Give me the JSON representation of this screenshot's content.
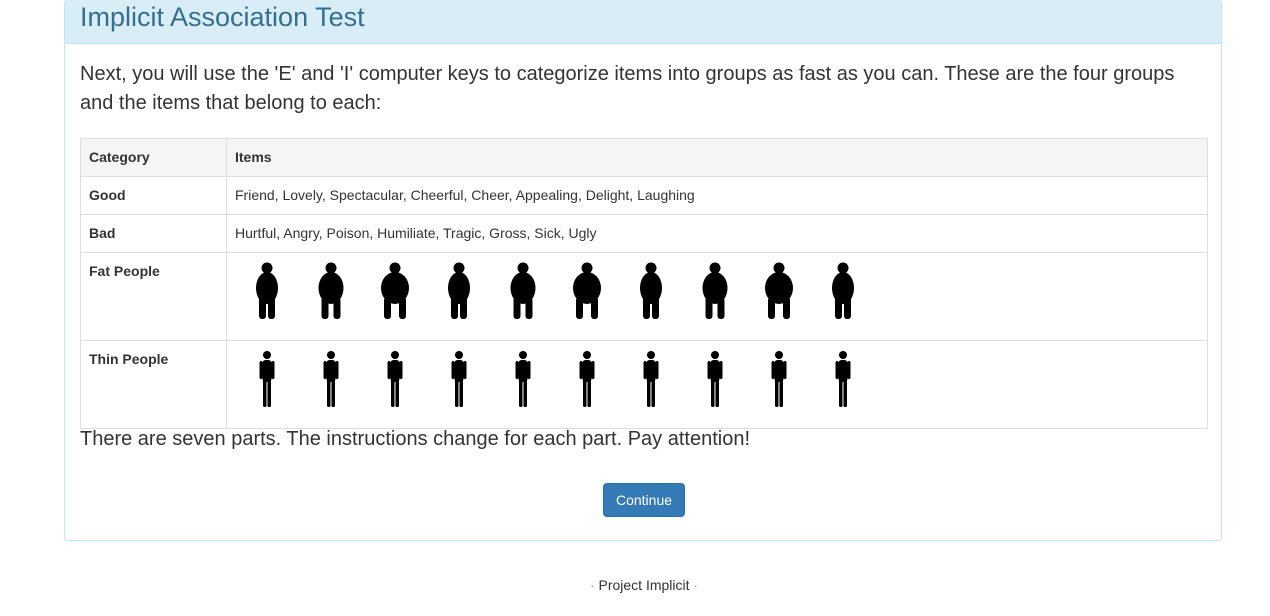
{
  "header": {
    "title": "Implicit Association Test"
  },
  "intro": "Next, you will use the 'E' and 'I' computer keys to categorize items into groups as fast as you can. These are the four groups and the items that belong to each:",
  "table": {
    "headers": [
      "Category",
      "Items"
    ],
    "rows": [
      {
        "category": "Good",
        "items": "Friend, Lovely, Spectacular, Cheerful, Cheer, Appealing, Delight, Laughing"
      },
      {
        "category": "Bad",
        "items": "Hurtful, Angry, Poison, Humiliate, Tragic, Gross, Sick, Ugly"
      },
      {
        "category": "Fat People",
        "image_icon": "fat-person-silhouette-icon",
        "image_count": 10
      },
      {
        "category": "Thin People",
        "image_icon": "thin-person-silhouette-icon",
        "image_count": 10
      }
    ]
  },
  "outro": "There are seven parts. The instructions change for each part. Pay attention!",
  "continue_button": {
    "label": "Continue",
    "color": "#337ab7"
  },
  "footer": {
    "text": "Project Implicit",
    "separator": "·"
  },
  "colors": {
    "heading_bg": "#d9edf7",
    "heading_text": "#31708f",
    "border": "#bce8f1"
  }
}
